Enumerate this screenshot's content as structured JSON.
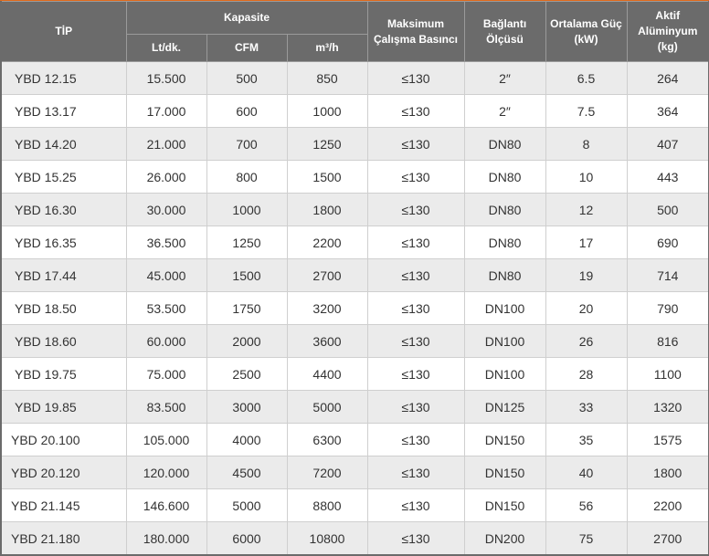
{
  "header": {
    "tip": "TİP",
    "kapasite": "Kapasite",
    "kapasite_sub": [
      "Lt/dk.",
      "CFM",
      "m³/h"
    ],
    "maksimum_line1": "Maksimum",
    "maksimum_line2": "Çalışma Basıncı",
    "baglanti_line1": "Bağlantı",
    "baglanti_line2": "Ölçüsü",
    "ortalama_line1": "Ortalama Güç",
    "ortalama_line2": "(kW)",
    "aktif_line1": "Aktif",
    "aktif_line2": "Alüminyum",
    "aktif_line3": "(kg)"
  },
  "rows": [
    {
      "tip": "YBD 12.15",
      "lt": "15.500",
      "cfm": "500",
      "m3h": "850",
      "basinc": "≤130",
      "baglanti": "2″",
      "guc": "6.5",
      "aluminyum": "264"
    },
    {
      "tip": "YBD 13.17",
      "lt": "17.000",
      "cfm": "600",
      "m3h": "1000",
      "basinc": "≤130",
      "baglanti": "2″",
      "guc": "7.5",
      "aluminyum": "364"
    },
    {
      "tip": "YBD 14.20",
      "lt": "21.000",
      "cfm": "700",
      "m3h": "1250",
      "basinc": "≤130",
      "baglanti": "DN80",
      "guc": "8",
      "aluminyum": "407"
    },
    {
      "tip": "YBD 15.25",
      "lt": "26.000",
      "cfm": "800",
      "m3h": "1500",
      "basinc": "≤130",
      "baglanti": "DN80",
      "guc": "10",
      "aluminyum": "443"
    },
    {
      "tip": "YBD 16.30",
      "lt": "30.000",
      "cfm": "1000",
      "m3h": "1800",
      "basinc": "≤130",
      "baglanti": "DN80",
      "guc": "12",
      "aluminyum": "500"
    },
    {
      "tip": "YBD 16.35",
      "lt": "36.500",
      "cfm": "1250",
      "m3h": "2200",
      "basinc": "≤130",
      "baglanti": "DN80",
      "guc": "17",
      "aluminyum": "690"
    },
    {
      "tip": "YBD 17.44",
      "lt": "45.000",
      "cfm": "1500",
      "m3h": "2700",
      "basinc": "≤130",
      "baglanti": "DN80",
      "guc": "19",
      "aluminyum": "714"
    },
    {
      "tip": "YBD 18.50",
      "lt": "53.500",
      "cfm": "1750",
      "m3h": "3200",
      "basinc": "≤130",
      "baglanti": "DN100",
      "guc": "20",
      "aluminyum": "790"
    },
    {
      "tip": "YBD 18.60",
      "lt": "60.000",
      "cfm": "2000",
      "m3h": "3600",
      "basinc": "≤130",
      "baglanti": "DN100",
      "guc": "26",
      "aluminyum": "816"
    },
    {
      "tip": "YBD 19.75",
      "lt": "75.000",
      "cfm": "2500",
      "m3h": "4400",
      "basinc": "≤130",
      "baglanti": "DN100",
      "guc": "28",
      "aluminyum": "1100"
    },
    {
      "tip": "YBD 19.85",
      "lt": "83.500",
      "cfm": "3000",
      "m3h": "5000",
      "basinc": "≤130",
      "baglanti": "DN125",
      "guc": "33",
      "aluminyum": "1320"
    },
    {
      "tip": "YBD 20.100",
      "lt": "105.000",
      "cfm": "4000",
      "m3h": "6300",
      "basinc": "≤130",
      "baglanti": "DN150",
      "guc": "35",
      "aluminyum": "1575"
    },
    {
      "tip": "YBD 20.120",
      "lt": "120.000",
      "cfm": "4500",
      "m3h": "7200",
      "basinc": "≤130",
      "baglanti": "DN150",
      "guc": "40",
      "aluminyum": "1800"
    },
    {
      "tip": "YBD 21.145",
      "lt": "146.600",
      "cfm": "5000",
      "m3h": "8800",
      "basinc": "≤130",
      "baglanti": "DN150",
      "guc": "56",
      "aluminyum": "2200"
    },
    {
      "tip": "YBD 21.180",
      "lt": "180.000",
      "cfm": "6000",
      "m3h": "10800",
      "basinc": "≤130",
      "baglanti": "DN200",
      "guc": "75",
      "aluminyum": "2700"
    }
  ],
  "colors": {
    "header_bg": "#6b6b6b",
    "header_text": "#ffffff",
    "row_alt_bg": "#ebebeb",
    "row_bg": "#ffffff",
    "accent": "#e06a1b"
  }
}
